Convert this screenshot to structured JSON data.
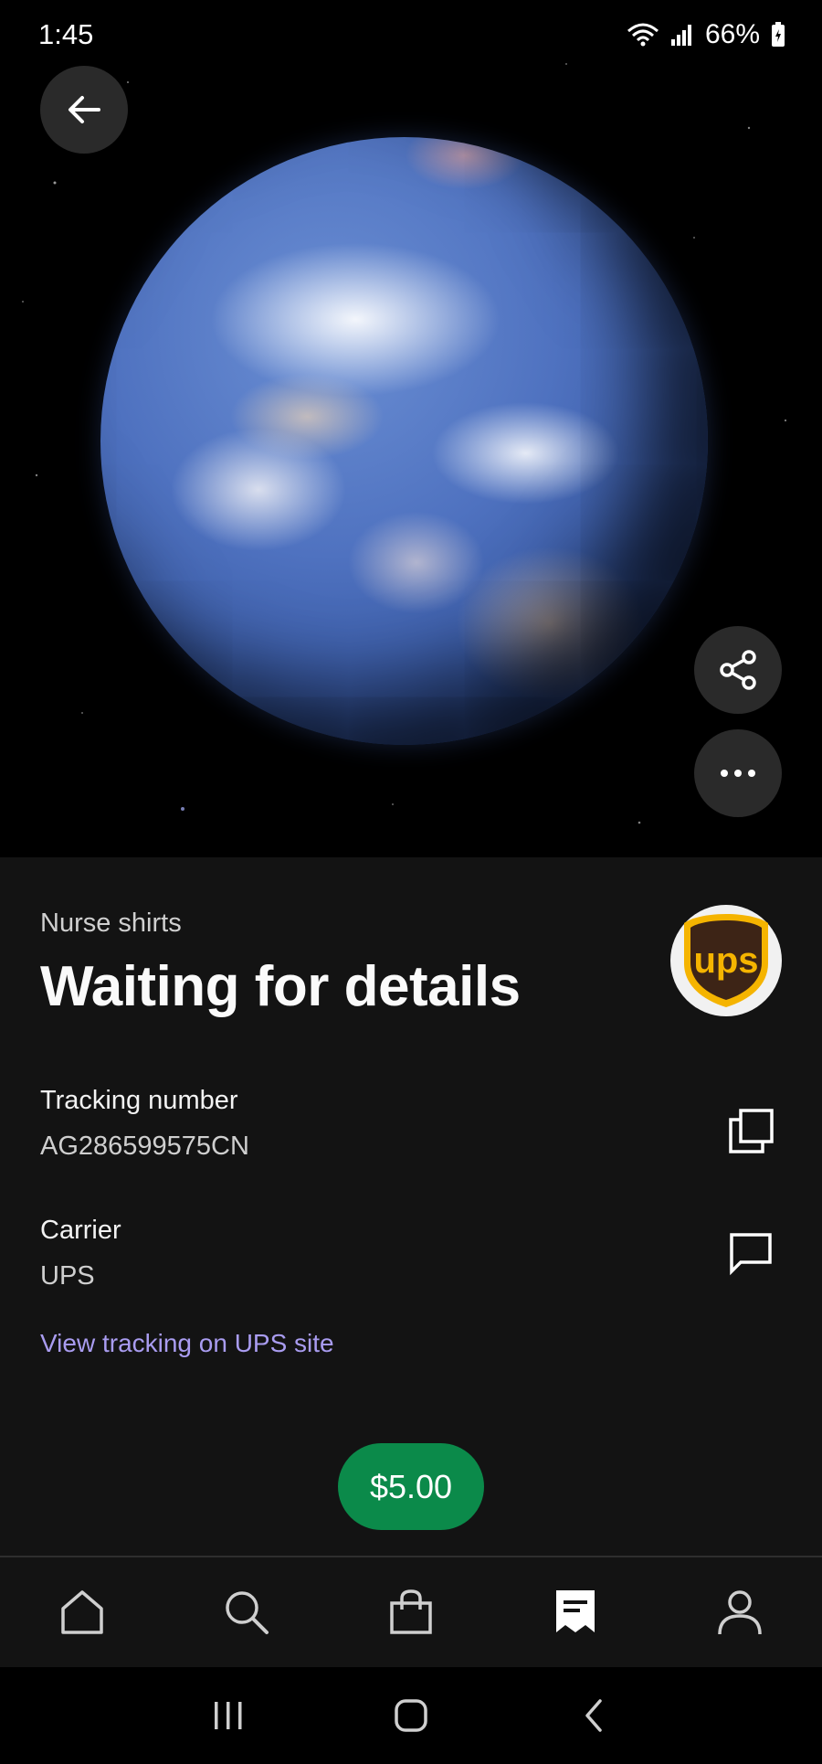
{
  "status_bar": {
    "time": "1:45",
    "battery": "66%",
    "icons": [
      "wifi-icon",
      "signal-icon",
      "battery-icon"
    ]
  },
  "hero": {
    "image": "earth-globe",
    "actions": [
      "back-arrow-icon",
      "share-icon",
      "more-icon"
    ]
  },
  "shipment": {
    "item_name": "Nurse shirts",
    "status": "Waiting for details",
    "carrier_logo": "ups-logo"
  },
  "tracking": {
    "label": "Tracking number",
    "value": "AG286599575CN",
    "action_icon": "copy-icon"
  },
  "carrier": {
    "label": "Carrier",
    "value": "UPS",
    "action_icon": "chat-icon"
  },
  "link": {
    "text": "View tracking on UPS site"
  },
  "price": {
    "amount": "$5.00"
  },
  "bottom_nav": {
    "items": [
      {
        "icon": "home-icon",
        "active": false
      },
      {
        "icon": "search-icon",
        "active": false
      },
      {
        "icon": "shopping-bag-icon",
        "active": false
      },
      {
        "icon": "receipt-icon",
        "active": true
      },
      {
        "icon": "profile-icon",
        "active": false
      }
    ]
  },
  "system_nav": {
    "icons": [
      "recents-icon",
      "home-circle-icon",
      "back-chevron-icon"
    ]
  },
  "colors": {
    "background": "#131313",
    "link": "#a99cf0",
    "price_pill": "#0b8a4a",
    "ups_brown": "#3d2416",
    "ups_gold": "#f5b400"
  }
}
